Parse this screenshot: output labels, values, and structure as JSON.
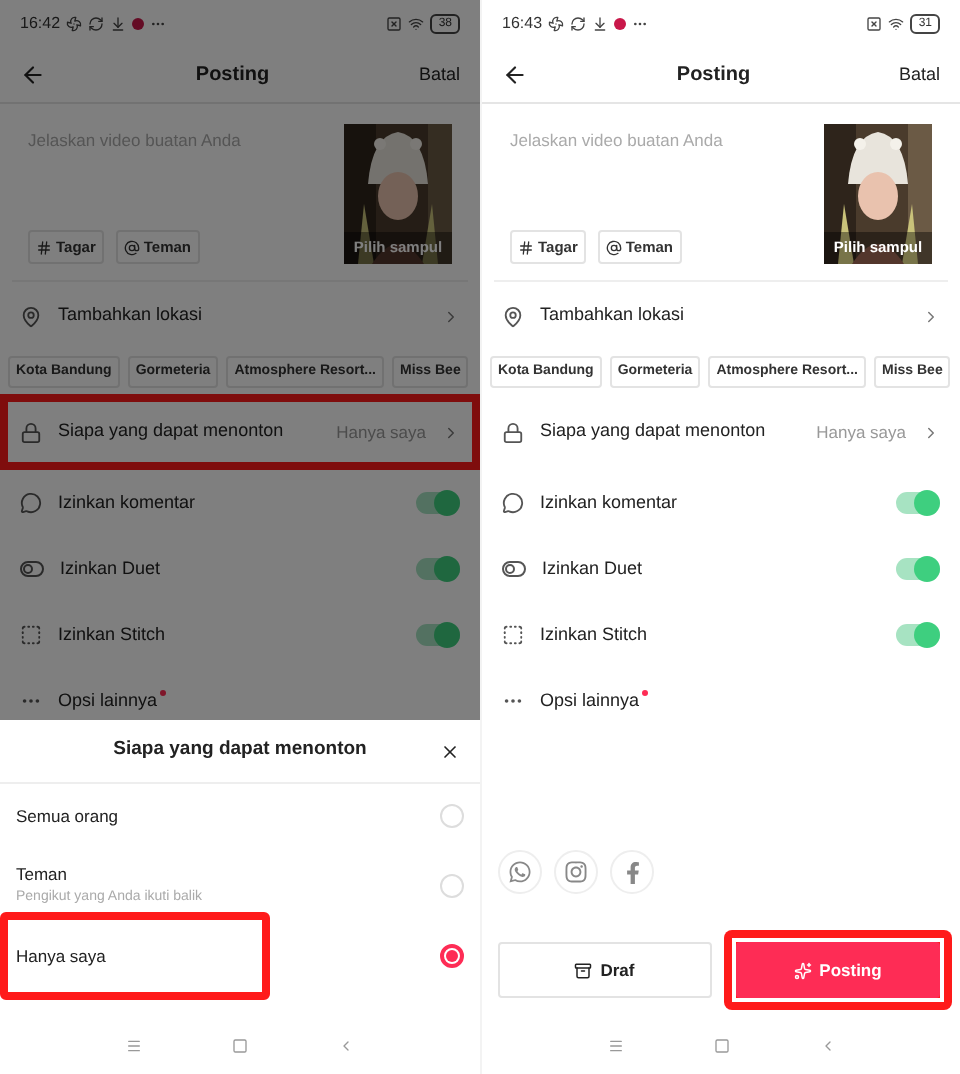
{
  "screens": [
    {
      "status_bar": {
        "time": "16:42",
        "notification": true,
        "battery": "38"
      },
      "header": {
        "title": "Posting",
        "action": "Batal"
      },
      "caption": {
        "placeholder": "Jelaskan video buatan Anda",
        "cover_label": "Pilih sampul"
      },
      "tags": [
        {
          "kind": "hashtag",
          "label": "Tagar"
        },
        {
          "kind": "mention",
          "label": "Teman"
        }
      ],
      "settings": [
        {
          "kind": "location",
          "label": "Tambahkan lokasi",
          "highlighted": false
        },
        {
          "kind": "privacy",
          "label": "Siapa yang dapat menonton",
          "value": "Hanya saya",
          "highlighted": true
        },
        {
          "kind": "comments",
          "label": "Izinkan komentar",
          "on": true
        },
        {
          "kind": "duet",
          "label": "Izinkan Duet",
          "on": true
        },
        {
          "kind": "stitch",
          "label": "Izinkan Stitch",
          "on": true
        },
        {
          "kind": "more",
          "label": "Opsi lainnya",
          "dot": true
        }
      ],
      "location_chips": [
        "Kota Bandung",
        "Gormeteria",
        "Atmosphere Resort...",
        "Miss Bee"
      ],
      "sheet": {
        "title": "Siapa yang dapat menonton",
        "options": [
          {
            "label": "Semua orang",
            "selected": false,
            "highlighted": false
          },
          {
            "label": "Teman",
            "sub": "Pengikut yang Anda ikuti balik",
            "selected": false,
            "highlighted": false
          },
          {
            "label": "Hanya saya",
            "selected": true,
            "highlighted": true
          }
        ]
      }
    },
    {
      "status_bar": {
        "time": "16:43",
        "notification": true,
        "battery": "31"
      },
      "header": {
        "title": "Posting",
        "action": "Batal"
      },
      "caption": {
        "placeholder": "Jelaskan video buatan Anda",
        "cover_label": "Pilih sampul"
      },
      "tags": [
        {
          "kind": "hashtag",
          "label": "Tagar"
        },
        {
          "kind": "mention",
          "label": "Teman"
        }
      ],
      "settings": [
        {
          "kind": "location",
          "label": "Tambahkan lokasi",
          "highlighted": false
        },
        {
          "kind": "privacy",
          "label": "Siapa yang dapat menonton",
          "value": "Hanya saya",
          "highlighted": false
        },
        {
          "kind": "comments",
          "label": "Izinkan komentar",
          "on": true
        },
        {
          "kind": "duet",
          "label": "Izinkan Duet",
          "on": true
        },
        {
          "kind": "stitch",
          "label": "Izinkan Stitch",
          "on": true
        },
        {
          "kind": "more",
          "label": "Opsi lainnya",
          "dot": true
        }
      ],
      "location_chips": [
        "Kota Bandung",
        "Gormeteria",
        "Atmosphere Resort...",
        "Miss Bee"
      ],
      "share": [
        {
          "kind": "whatsapp"
        },
        {
          "kind": "instagram"
        },
        {
          "kind": "facebook"
        }
      ],
      "actions": [
        {
          "kind": "draft",
          "label": "Draf",
          "highlighted": false
        },
        {
          "kind": "post",
          "label": "Posting",
          "highlighted": true
        }
      ]
    }
  ]
}
